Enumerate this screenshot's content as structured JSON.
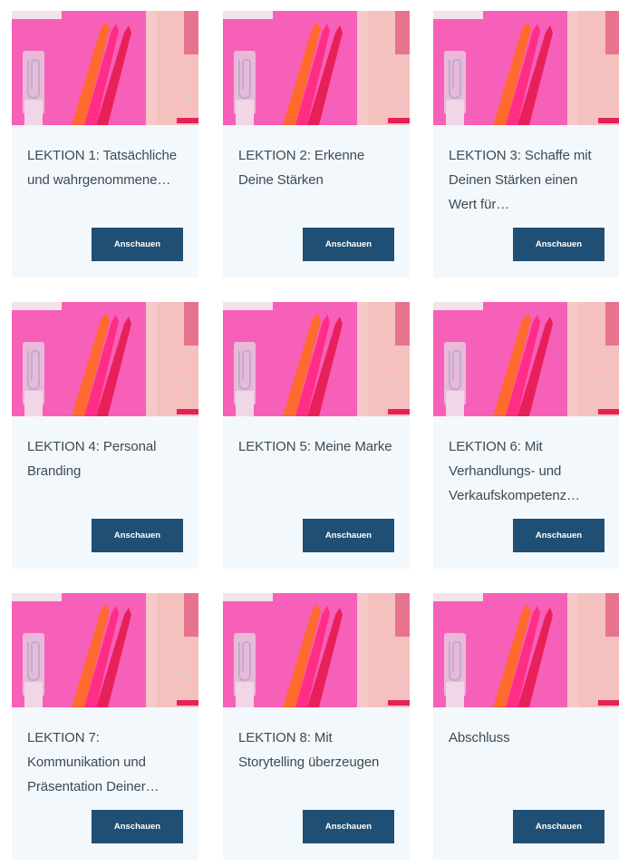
{
  "lessons": [
    {
      "title": "LEKTION 1: Tatsächliche und wahrgenommene…",
      "button_label": "Anschauen"
    },
    {
      "title": "LEKTION 2: Erkenne Deine Stärken",
      "button_label": "Anschauen"
    },
    {
      "title": "LEKTION 3: Schaffe mit Deinen Stärken einen Wert für…",
      "button_label": "Anschauen"
    },
    {
      "title": "LEKTION 4: Personal Branding",
      "button_label": "Anschauen"
    },
    {
      "title": "LEKTION 5: Meine Marke",
      "button_label": "Anschauen"
    },
    {
      "title": "LEKTION 6: Mit Verhandlungs- und Verkaufskompetenz…",
      "button_label": "Anschauen"
    },
    {
      "title": "LEKTION 7: Kommunikation und Präsentation Deiner…",
      "button_label": "Anschauen"
    },
    {
      "title": "LEKTION 8: Mit Storytelling überzeugen",
      "button_label": "Anschauen"
    },
    {
      "title": "Abschluss",
      "button_label": "Anschauen"
    }
  ],
  "thumbnail": {
    "icon": "pink-desk-pencils-image",
    "colors": {
      "background": "#f760b8",
      "orange_pencil": "#ff6a2e",
      "pink_pencil": "#ff2d86",
      "red_pencil": "#e8205a",
      "paper": "#f7c9c6",
      "clip": "#e8c9de"
    }
  },
  "colors": {
    "card_background": "#f3f8fc",
    "button_background": "#1f4f74",
    "button_text": "#ffffff",
    "title_text": "#3d4a55"
  }
}
